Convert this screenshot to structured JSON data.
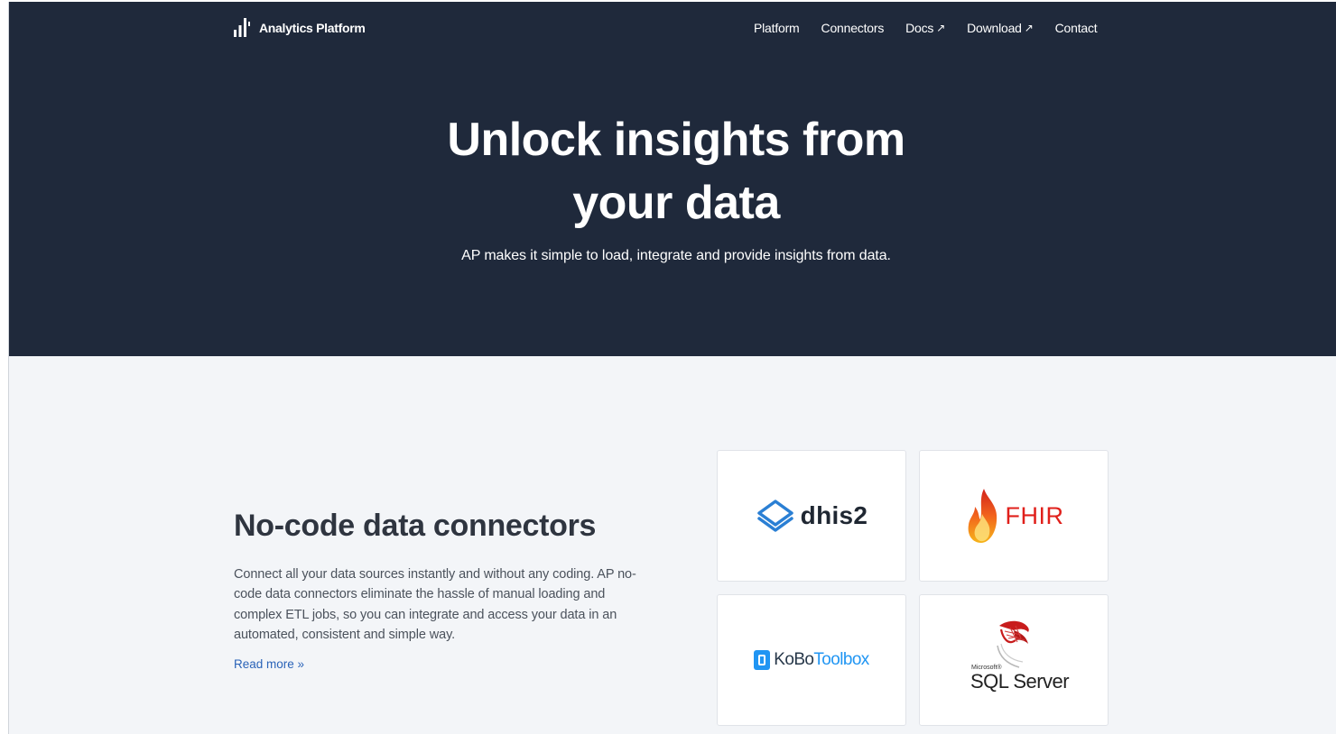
{
  "header": {
    "brand_name": "Analytics Platform",
    "brand_icon": "bar-chart-icon",
    "nav": [
      {
        "label": "Platform",
        "external": false
      },
      {
        "label": "Connectors",
        "external": false
      },
      {
        "label": "Docs",
        "external": true,
        "external_icon": "↗"
      },
      {
        "label": "Download",
        "external": true,
        "external_icon": "↗"
      },
      {
        "label": "Contact",
        "external": false
      }
    ]
  },
  "hero": {
    "title_line1": "Unlock insights from",
    "title_line2": "your data",
    "subtitle": "AP makes it simple to load, integrate and provide insights from data."
  },
  "connectors_section": {
    "title": "No-code data connectors",
    "body": "Connect all your data sources instantly and without any coding. AP no-code data connectors eliminate the hassle of manual loading and complex ETL jobs, so you can integrate and access your data in an automated, consistent and simple way.",
    "read_more": "Read more »",
    "logos": {
      "dhis2": "dhis2",
      "fhir": "FHIR",
      "kobo_a": "KoBo",
      "kobo_b": "Toolbox",
      "sql_ms": "Microsoft®",
      "sql": "SQL Server"
    }
  },
  "colors": {
    "hero_bg": "#1f293b",
    "page_bg": "#f3f5f8",
    "link": "#2a63b8",
    "fhir_red": "#e0201b",
    "kobo_blue": "#2095f3"
  }
}
